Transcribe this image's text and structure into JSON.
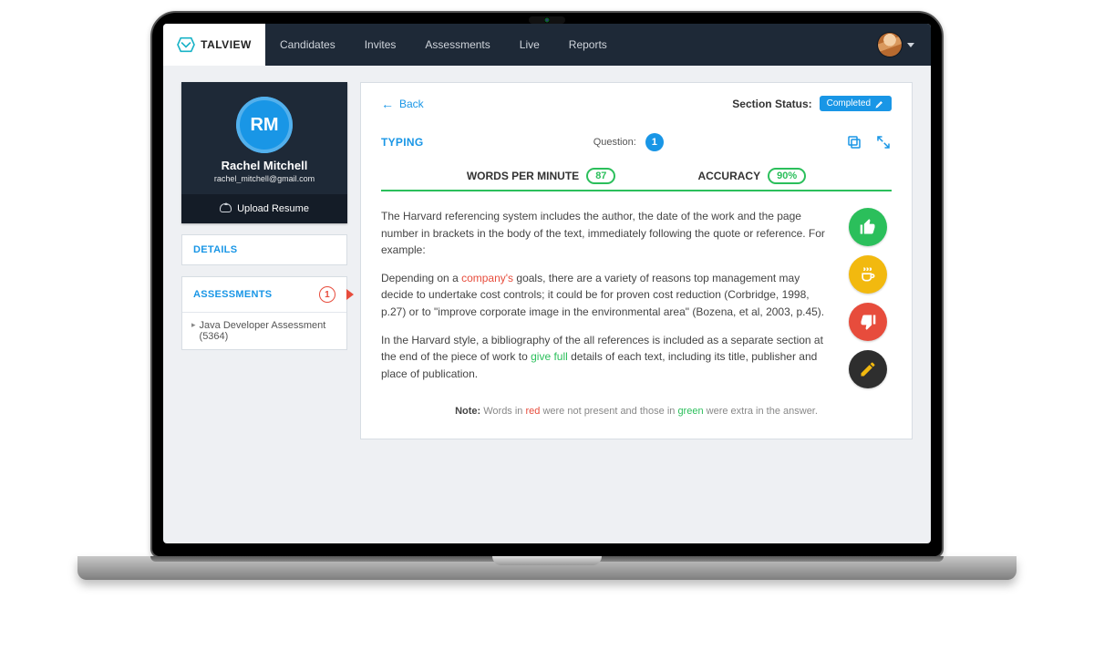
{
  "brand": {
    "name": "TALVIEW"
  },
  "nav": {
    "items": [
      "Candidates",
      "Invites",
      "Assessments",
      "Live",
      "Reports"
    ]
  },
  "candidate": {
    "initials": "RM",
    "name": "Rachel Mitchell",
    "email": "rachel_mitchell@gmail.com",
    "upload_label": "Upload Resume"
  },
  "side_tabs": {
    "details_label": "DETAILS",
    "assessments_label": "ASSESSMENTS",
    "assessments_count": "1",
    "assessment_row": "Java Developer Assessment (5364)"
  },
  "header": {
    "back_label": "Back",
    "status_label": "Section Status:",
    "status_value": "Completed"
  },
  "section": {
    "title": "TYPING",
    "question_label": "Question:",
    "question_num": "1"
  },
  "metrics": {
    "wpm_label": "WORDS PER MINUTE",
    "wpm_value": "87",
    "acc_label": "ACCURACY",
    "acc_value": "90%"
  },
  "passage": {
    "p1": "The Harvard referencing system includes the author, the date of the work and the page number in brackets in the body of the text, immediately following the quote or reference. For example:",
    "p2_a": "Depending on a ",
    "p2_err": "company's",
    "p2_b": " goals, there are a variety of reasons top management may decide to undertake cost controls; it could be for proven cost reduction (Corbridge, 1998, p.27) or to \"improve corporate image in the environmental area\" (Bozena, et al, 2003, p.45).",
    "p3_a": "In the Harvard style, a bibliography of the all references is included as a separate section at the end of the piece of work to ",
    "p3_extra": "give full",
    "p3_b": " details of each text, including its title, publisher and place of publication."
  },
  "legend": {
    "note_label": "Note:",
    "a": " Words in ",
    "red": "red",
    "b": " were not present and those in ",
    "green": "green",
    "c": " were extra in the answer."
  },
  "rating_icons": {
    "up": "thumbs-up-icon",
    "hold": "coffee-icon",
    "down": "thumbs-down-icon",
    "edit": "pencil-icon"
  }
}
